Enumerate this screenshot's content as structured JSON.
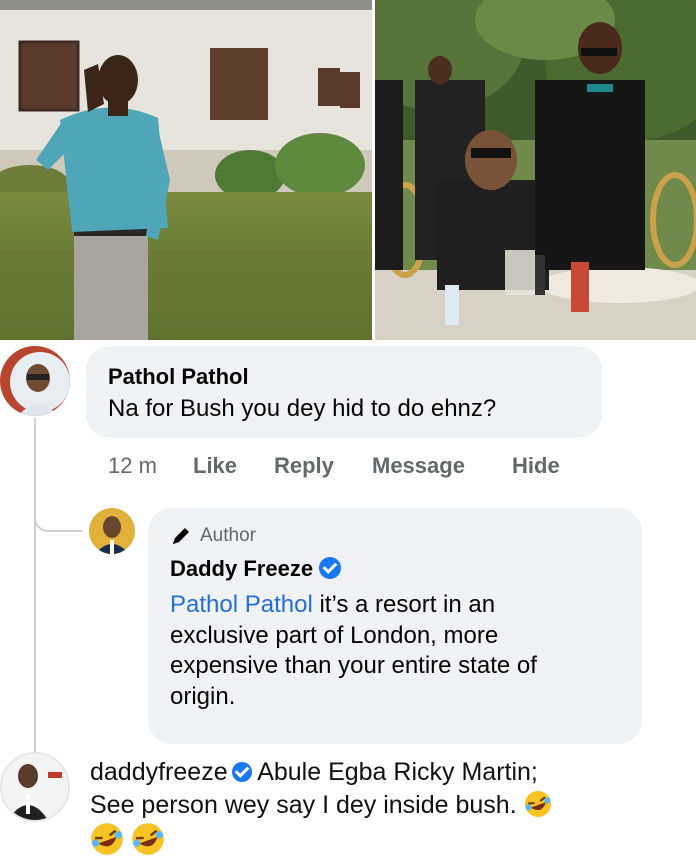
{
  "comment1": {
    "name": "Pathol Pathol",
    "text": "Na for Bush you dey hid to do ehnz?",
    "actions": {
      "time": "12 m",
      "like": "Like",
      "reply": "Reply",
      "message": "Message",
      "hide": "Hide"
    }
  },
  "reply1": {
    "author_badge": "Author",
    "name": "Daddy Freeze",
    "mention": "Pathol Pathol",
    "text_line1": " it’s a resort in an",
    "text_line2": "exclusive part of London, more",
    "text_line3": "expensive than your entire state of",
    "text_line4": "origin."
  },
  "caption": {
    "username": "daddyfreeze",
    "text_line1": "Abule Egba Ricky Martin;",
    "text_line2": "See person wey say I dey inside bush."
  },
  "colors": {
    "bubble": "#f0f2f5",
    "mention": "#216fdb",
    "verified": "#1877f2",
    "muted": "#65676b"
  },
  "icons": [
    "pencil-icon",
    "verified-badge-icon",
    "rolling-laughing-emoji"
  ]
}
